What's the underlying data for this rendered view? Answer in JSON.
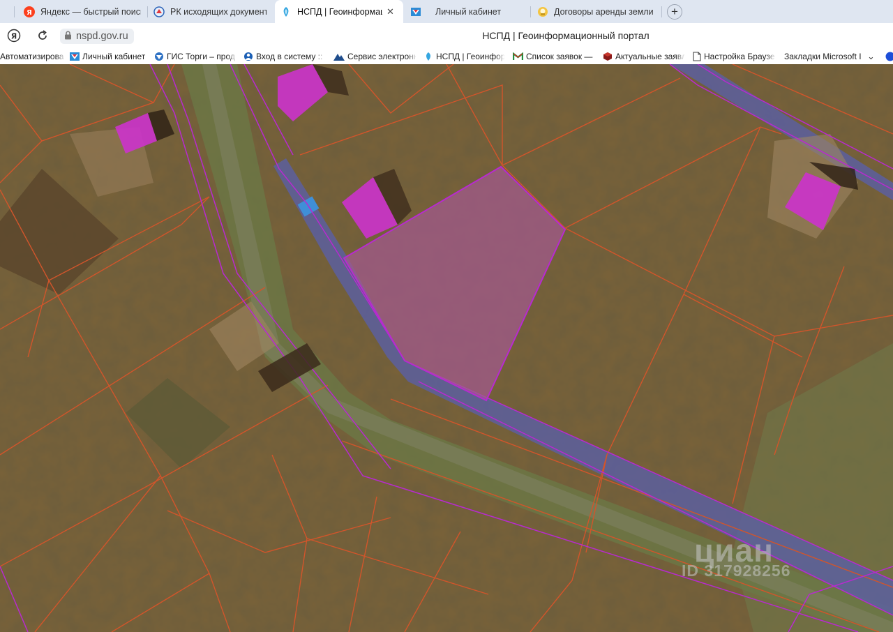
{
  "browser": {
    "tabs": [
      {
        "title": "Яндекс — быстрый поиск",
        "icon": "yandex-icon",
        "active": false
      },
      {
        "title": "РК исходящих документов",
        "icon": "pk-docs-icon",
        "active": false
      },
      {
        "title": "НСПД | Геоинформационный портал",
        "icon": "nspd-icon",
        "active": true
      },
      {
        "title": "Личный кабинет",
        "icon": "gosuslugi-icon",
        "active": false
      },
      {
        "title": "Договоры аренды земли",
        "icon": "land-contract-icon",
        "active": false
      }
    ],
    "new_tab_symbol": "+",
    "close_symbol": "✕",
    "url": "nspd.gov.ru",
    "page_title": "НСПД | Геоинформационный портал",
    "yandex_button": "Я"
  },
  "bookmarks": [
    {
      "label": "Автоматизирован",
      "icon": "none"
    },
    {
      "label": "Личный кабинет",
      "icon": "gosuslugi-icon"
    },
    {
      "label": "ГИС Торги – прод",
      "icon": "gis-torgi-icon"
    },
    {
      "label": "Вход в систему :: I",
      "icon": "login-system-icon"
    },
    {
      "label": "Сервис электронн",
      "icon": "e-service-icon"
    },
    {
      "label": "НСПД | Геоинфор",
      "icon": "nspd-icon"
    },
    {
      "label": "Список заявок —",
      "icon": "gmail-icon"
    },
    {
      "label": "Актуальные заявл",
      "icon": "cube-icon"
    },
    {
      "label": "Настройка Браузе",
      "icon": "document-icon"
    },
    {
      "label": "Закладки Microsoft I",
      "icon": "none"
    }
  ],
  "bookmarks_more": "⌄",
  "map": {
    "watermark_logo": "циан",
    "watermark_id": "ID 317928256",
    "colors": {
      "ground": "#7a6238",
      "parcel_border": "#d2552b",
      "boundary_line": "#b82ad0",
      "road": "#5a5fa8",
      "selected_parcel": "#a3598f",
      "building": "#cc33cc",
      "grass_strip": "#6b7a47"
    }
  }
}
